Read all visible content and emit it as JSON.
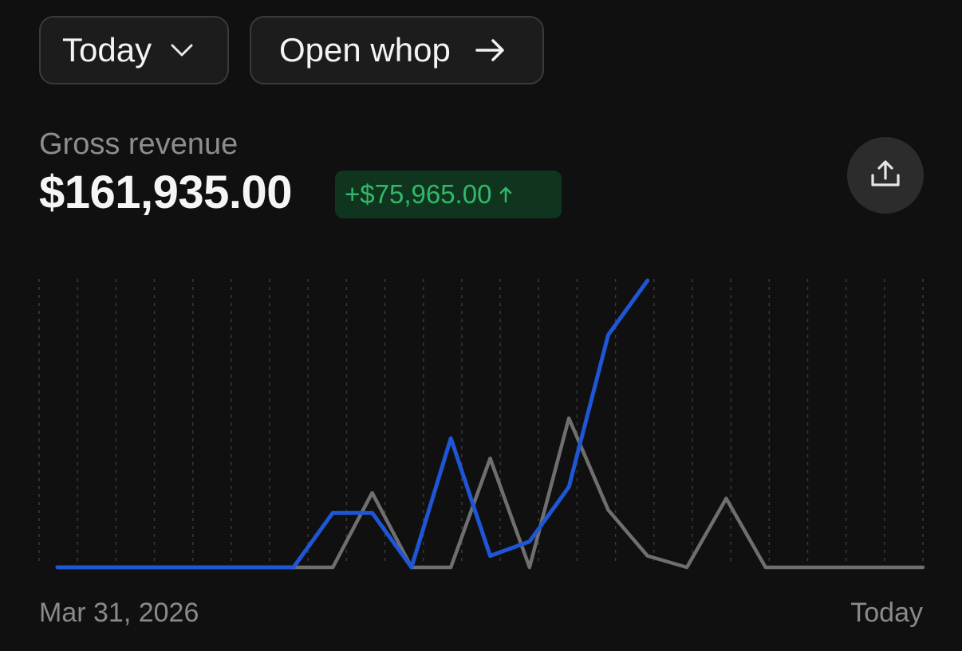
{
  "controls": {
    "period_label": "Today",
    "open_label": "Open whop"
  },
  "metric": {
    "label": "Gross revenue",
    "value": "$161,935.00",
    "delta": "+$75,965.00"
  },
  "icons": {
    "period": "chevron-down-icon",
    "open": "arrow-right-icon",
    "delta": "arrow-up-icon",
    "share": "share-upload-icon"
  },
  "colors": {
    "background": "#101010",
    "current_series": "#1f56d6",
    "previous_series": "#6f6f6f",
    "delta_text": "#33b86a",
    "delta_bg": "#10351f"
  },
  "chart_data": {
    "type": "line",
    "x": [
      0,
      1,
      2,
      3,
      4,
      5,
      6,
      7,
      8,
      9,
      10,
      11,
      12,
      13,
      14,
      15,
      16,
      17,
      18,
      19,
      20,
      21,
      22
    ],
    "series": [
      {
        "values": [
          0,
          0,
          0,
          0,
          0,
          0,
          0,
          0,
          26,
          0,
          0,
          38,
          0,
          52,
          20,
          4,
          0,
          24,
          0,
          0,
          0,
          0,
          0
        ]
      },
      {
        "values": [
          0,
          0,
          0,
          0,
          0,
          0,
          0,
          19,
          19,
          0,
          45,
          4,
          9,
          28,
          81,
          100
        ]
      }
    ],
    "ylim": [
      0,
      100
    ],
    "grid": "vertical-dashed",
    "start_label": "Mar 31, 2026",
    "end_label": "Today"
  }
}
